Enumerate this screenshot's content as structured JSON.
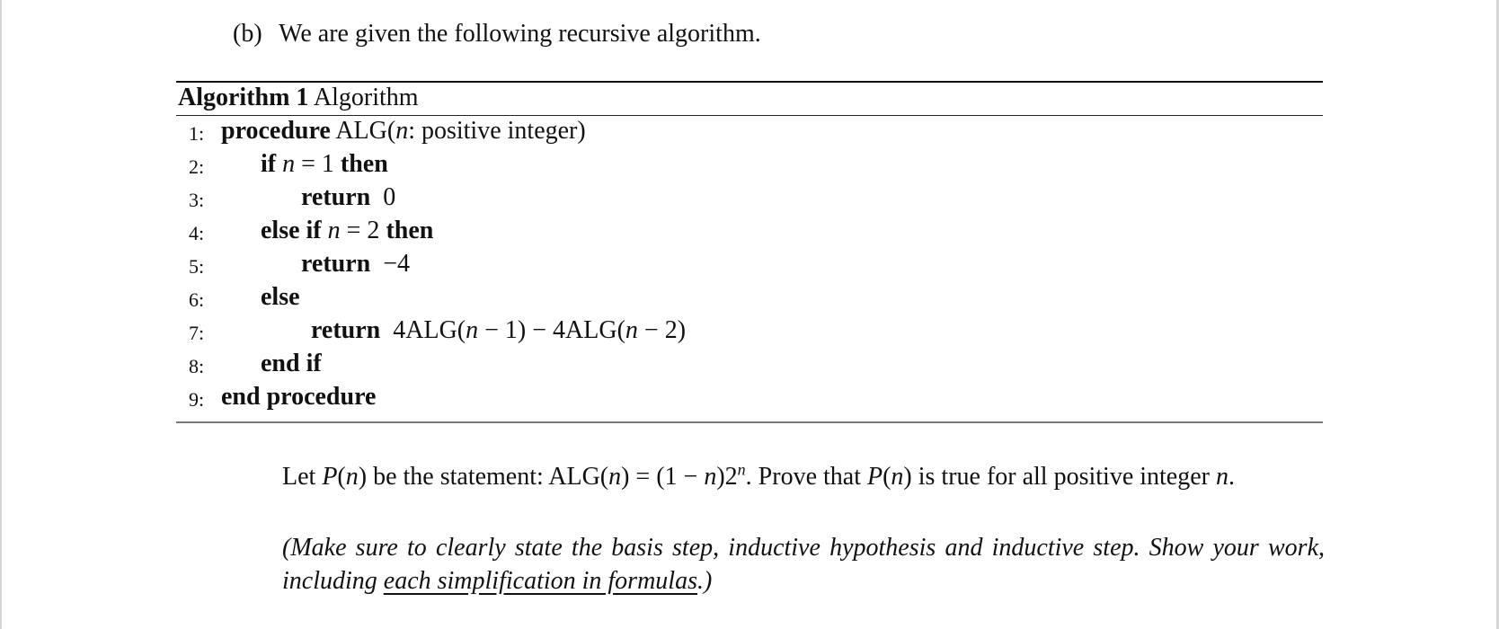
{
  "heading": {
    "label": "(b)",
    "text": "We are given the following recursive algorithm."
  },
  "algorithm": {
    "caption_bold": "Algorithm 1",
    "caption_title": "Algorithm",
    "lines": [
      {
        "num": "1:",
        "parts": {
          "kw1": "procedure",
          "rest": "ALG(",
          "var": "n",
          "rest2": ": positive integer)"
        }
      },
      {
        "num": "2:",
        "parts": {
          "kw1": "if",
          "var": "n",
          "rest": " = 1 ",
          "kw2": "then"
        }
      },
      {
        "num": "3:",
        "parts": {
          "kw1": "return",
          "rest": "0"
        }
      },
      {
        "num": "4:",
        "parts": {
          "kw1": "else if",
          "var": "n",
          "rest": " = 2 ",
          "kw2": "then"
        }
      },
      {
        "num": "5:",
        "parts": {
          "kw1": "return",
          "rest": "−4"
        }
      },
      {
        "num": "6:",
        "parts": {
          "kw1": "else"
        }
      },
      {
        "num": "7:",
        "parts": {
          "kw1": "return",
          "rest_a": "4ALG(",
          "var1": "n",
          "rest_b": " − 1) − 4ALG(",
          "var2": "n",
          "rest_c": " − 2)"
        }
      },
      {
        "num": "8:",
        "parts": {
          "kw1": "end if"
        }
      },
      {
        "num": "9:",
        "parts": {
          "kw1": "end procedure"
        }
      }
    ]
  },
  "statement": {
    "t1": "Let ",
    "p1": "P",
    "t2": "(",
    "n1": "n",
    "t3": ") be the statement: ALG(",
    "n2": "n",
    "t4": ") = (1 − ",
    "n3": "n",
    "t5": ")2",
    "exp": "n",
    "t6": ". Prove that ",
    "p2": "P",
    "t7": "(",
    "n4": "n",
    "t8": ") is true for all positive integer ",
    "n5": "n",
    "t9": "."
  },
  "note": {
    "before": "(Make sure to clearly state the basis step, inductive hypothesis and inductive step. Show your work, including ",
    "underlined": "each simplification in formulas",
    "after": ".)"
  }
}
